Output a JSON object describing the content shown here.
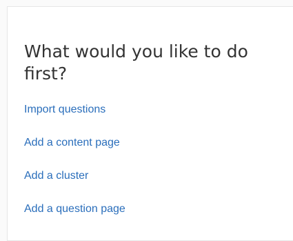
{
  "panel": {
    "heading": "What would you like to do first?",
    "actions": [
      {
        "label": "Import questions"
      },
      {
        "label": "Add a content page"
      },
      {
        "label": "Add a cluster"
      },
      {
        "label": "Add a question page"
      }
    ]
  },
  "colors": {
    "link": "#2a6ebb",
    "heading": "#333333",
    "background": "#ffffff",
    "border": "#e6e6e6"
  }
}
